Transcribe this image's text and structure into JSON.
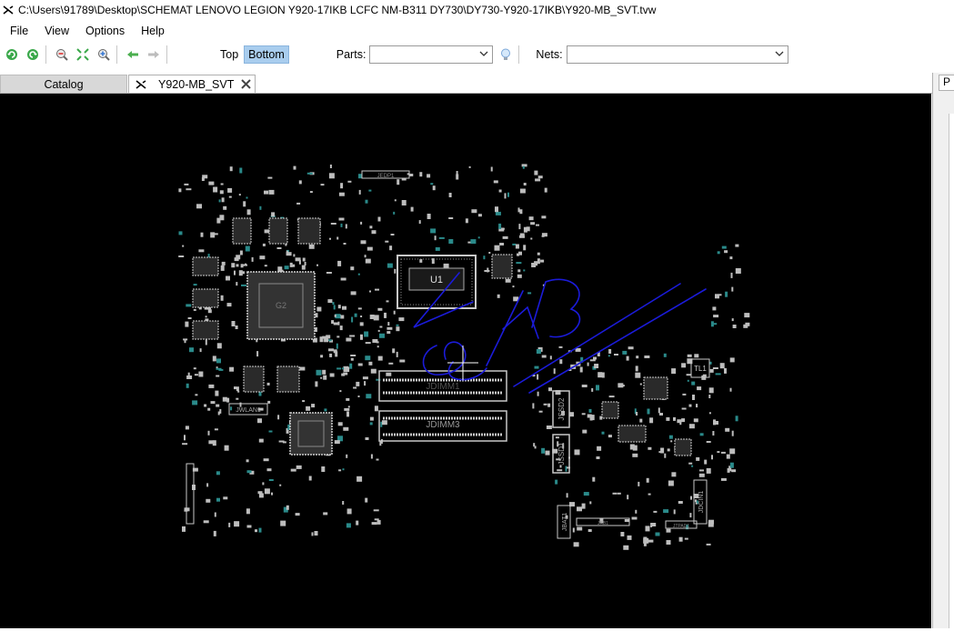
{
  "window": {
    "title": "C:\\Users\\91789\\Desktop\\SCHEMAT LENOVO LEGION Y920-17IKB LCFC NM-B311 DY730\\DY730-Y920-17IKB\\Y920-MB_SVT.tvw"
  },
  "menu": [
    "File",
    "View",
    "Options",
    "Help"
  ],
  "toolbar": {
    "top_label": "Top",
    "bottom_label": "Bottom",
    "active_side": "Bottom",
    "parts_label": "Parts:",
    "parts_value": "",
    "nets_label": "Nets:",
    "nets_value": "",
    "icons": [
      "rotate-left-icon",
      "rotate-right-icon",
      "zoom-out-icon",
      "fit-view-icon",
      "zoom-in-icon",
      "back-arrow-icon",
      "forward-arrow-icon",
      "lightbulb-icon"
    ]
  },
  "tabs": {
    "catalog": "Catalog",
    "active_file": "Y920-MB_SVT"
  },
  "right_panel": {
    "tab_label": "P"
  },
  "board": {
    "labels": {
      "u1": "U1",
      "g2": "G2",
      "jdimm1": "JDIMM1",
      "jdimm3": "JDIMM3",
      "jwlan1": "JWLAN1",
      "jssd2": "JSSD2",
      "jssd1": "JSSD1",
      "jbat1": "JBAT1",
      "jdcin1": "JDCIN1",
      "tl1": "TL1",
      "jedp1": "JEDP1",
      "jkb1": "JKB1",
      "jtpad1": "JTPAD1"
    },
    "colors": {
      "background": "#000000",
      "silkscreen": "#c8c8c8",
      "ink": "#1b1bd9",
      "cursor": "#ffffff"
    }
  }
}
